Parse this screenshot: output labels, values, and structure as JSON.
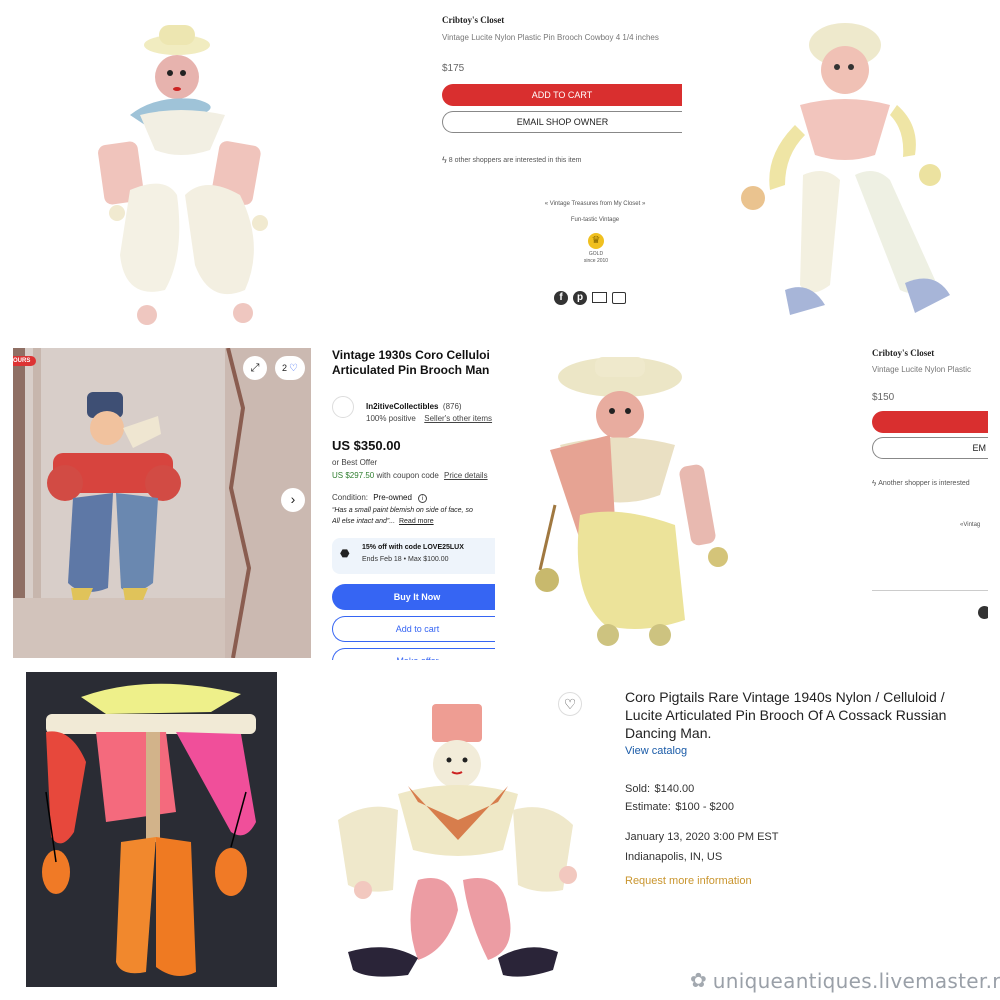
{
  "etsy_top": {
    "shop_name": "Cribtoy's Closet",
    "title": "Vintage Lucite Nylon Plastic Pin Brooch Cowboy 4 1/4 inches",
    "price": "$175",
    "add_to_cart": "ADD TO CART",
    "email_shop_owner": "EMAIL SHOP OWNER",
    "interest_note": "8 other shoppers are interested in this item",
    "tagline": "« Vintage Treasures from My Closet »",
    "subtitle": "Fun-tastic Vintage",
    "badge_label": "GOLD",
    "badge_since": "since 2010"
  },
  "etsy_mid": {
    "shop_name": "Cribtoy's Closet",
    "title": "Vintage Lucite Nylon Plastic",
    "price": "$150",
    "email_cut": "EM",
    "interest_note": "Another shopper is interested",
    "tagline_cut": "«Vintag"
  },
  "ebay": {
    "ribbon": "OURS",
    "image_count": "2",
    "title_line1": "Vintage 1930s Coro Celluloi",
    "title_line2": "Articulated Pin Brooch Man",
    "seller_name": "In2itiveCollectibles",
    "seller_count": "(876)",
    "seller_positive": "100% positive",
    "seller_other": "Seller's other items",
    "price": "US $350.00",
    "best_offer": "or Best Offer",
    "coupon_price": "US $297.50",
    "coupon_text": "with coupon code",
    "price_details": "Price details",
    "condition_label": "Condition:",
    "condition_value": "Pre-owned",
    "condition_quote_1": "“Has a small paint blemish on side of face, so",
    "condition_quote_2": "All else intact and”...",
    "read_more": "Read more",
    "promo_title": "15% off with code LOVE25LUX",
    "promo_sub": "Ends Feb 18 • Max $100.00",
    "buy_now": "Buy It Now",
    "add_to_cart": "Add to cart",
    "make_offer": "Make offer"
  },
  "auction": {
    "title": "Coro Pigtails Rare Vintage 1940s Nylon / Celluloid / Lucite Articulated Pin Brooch Of A Cossack Russian Dancing Man.",
    "view_catalog": "View catalog",
    "sold_label": "Sold:",
    "sold_value": "$140.00",
    "estimate_label": "Estimate:",
    "estimate_value": "$100 - $200",
    "date": "January 13, 2020 3:00 PM EST",
    "location": "Indianapolis, IN, US",
    "request_info": "Request more information"
  },
  "watermark": "uniqueantiques.livemaster.ru",
  "colors": {
    "etsy_red": "#d92f2f",
    "ebay_blue": "#3665f3",
    "ebay_green": "#2d7d2d",
    "auction_link": "#1a5ba8",
    "auction_gold": "#c9952e"
  },
  "icons": [
    "facebook-icon",
    "pinterest-icon",
    "mail-icon",
    "print-icon",
    "expand-icon",
    "heart-icon",
    "chevron-right-icon",
    "tag-icon",
    "info-icon",
    "crown-badge-icon",
    "lightning-icon",
    "favorite-heart-icon"
  ]
}
